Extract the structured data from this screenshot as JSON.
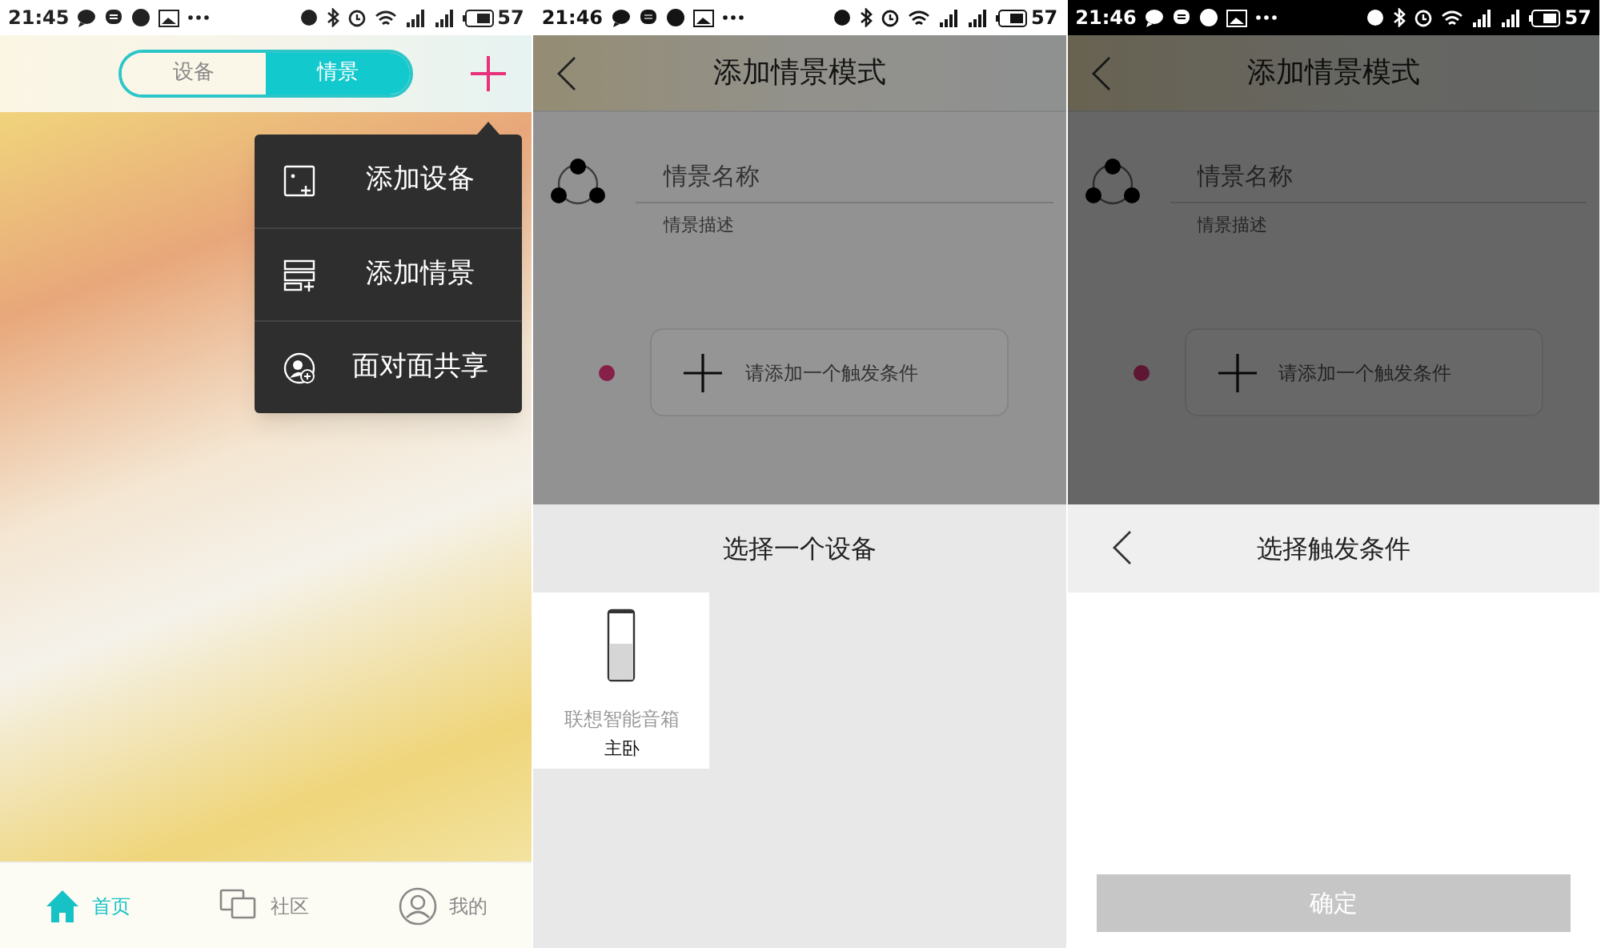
{
  "screens": [
    {
      "kind": "home",
      "dimmed": false,
      "status_bar": {
        "time": "21:45",
        "battery": "57",
        "dark": false
      },
      "segments": [
        {
          "label": "设备",
          "selected": false
        },
        {
          "label": "情景",
          "selected": true
        }
      ],
      "menu": [
        {
          "label": "添加设备"
        },
        {
          "label": "添加情景"
        },
        {
          "label": "面对面共享"
        }
      ],
      "bottom_nav": [
        {
          "label": "首页",
          "selected": true
        },
        {
          "label": "社区",
          "selected": false
        },
        {
          "label": "我的",
          "selected": false
        }
      ]
    },
    {
      "kind": "device_picker",
      "dimmed": true,
      "status_bar": {
        "time": "21:46",
        "battery": "57",
        "dark": false
      },
      "title": "添加情景模式",
      "name_placeholder": "情景名称",
      "description_placeholder": "情景描述",
      "trigger_placeholder": "请添加一个触发条件",
      "sheet": {
        "title": "选择一个设备",
        "devices": [
          {
            "name": "联想智能音箱",
            "room": "主卧"
          }
        ]
      }
    },
    {
      "kind": "trigger_picker",
      "dimmed": true,
      "status_bar": {
        "time": "21:46",
        "battery": "57",
        "dark": true
      },
      "title": "添加情景模式",
      "name_placeholder": "情景名称",
      "description_placeholder": "情景描述",
      "trigger_placeholder": "请添加一个触发条件",
      "sheet": {
        "title": "选择触发条件",
        "confirm": {
          "label": "确定",
          "disabled": true
        }
      }
    }
  ]
}
